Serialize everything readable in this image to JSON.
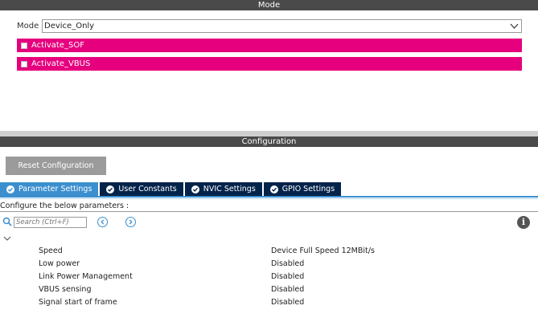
{
  "mode_section": {
    "title": "Mode",
    "mode_label": "Mode",
    "mode_value": "Device_Only",
    "checkbox_rows": [
      {
        "label": "Activate_SOF",
        "checked": false
      },
      {
        "label": "Activate_VBUS",
        "checked": false
      }
    ]
  },
  "config_section": {
    "title": "Configuration",
    "reset_button": "Reset Configuration",
    "tabs": [
      {
        "label": "Parameter Settings",
        "active": true
      },
      {
        "label": "User Constants",
        "active": false
      },
      {
        "label": "NVIC Settings",
        "active": false
      },
      {
        "label": "GPIO Settings",
        "active": false
      }
    ],
    "instruction": "Configure the below parameters :",
    "search_placeholder": "Search (Ctrl+F)",
    "parameters": [
      {
        "name": "Speed",
        "value": "Device Full Speed 12MBit/s"
      },
      {
        "name": "Low power",
        "value": "Disabled"
      },
      {
        "name": "Link Power Management",
        "value": "Disabled"
      },
      {
        "name": "VBUS sensing",
        "value": "Disabled"
      },
      {
        "name": "Signal start of frame",
        "value": "Disabled"
      }
    ]
  },
  "colors": {
    "header_bg": "#4a4a4a",
    "magenta": "#e6007e",
    "tab_dark": "#03234b",
    "tab_active": "#3b8fcf"
  }
}
